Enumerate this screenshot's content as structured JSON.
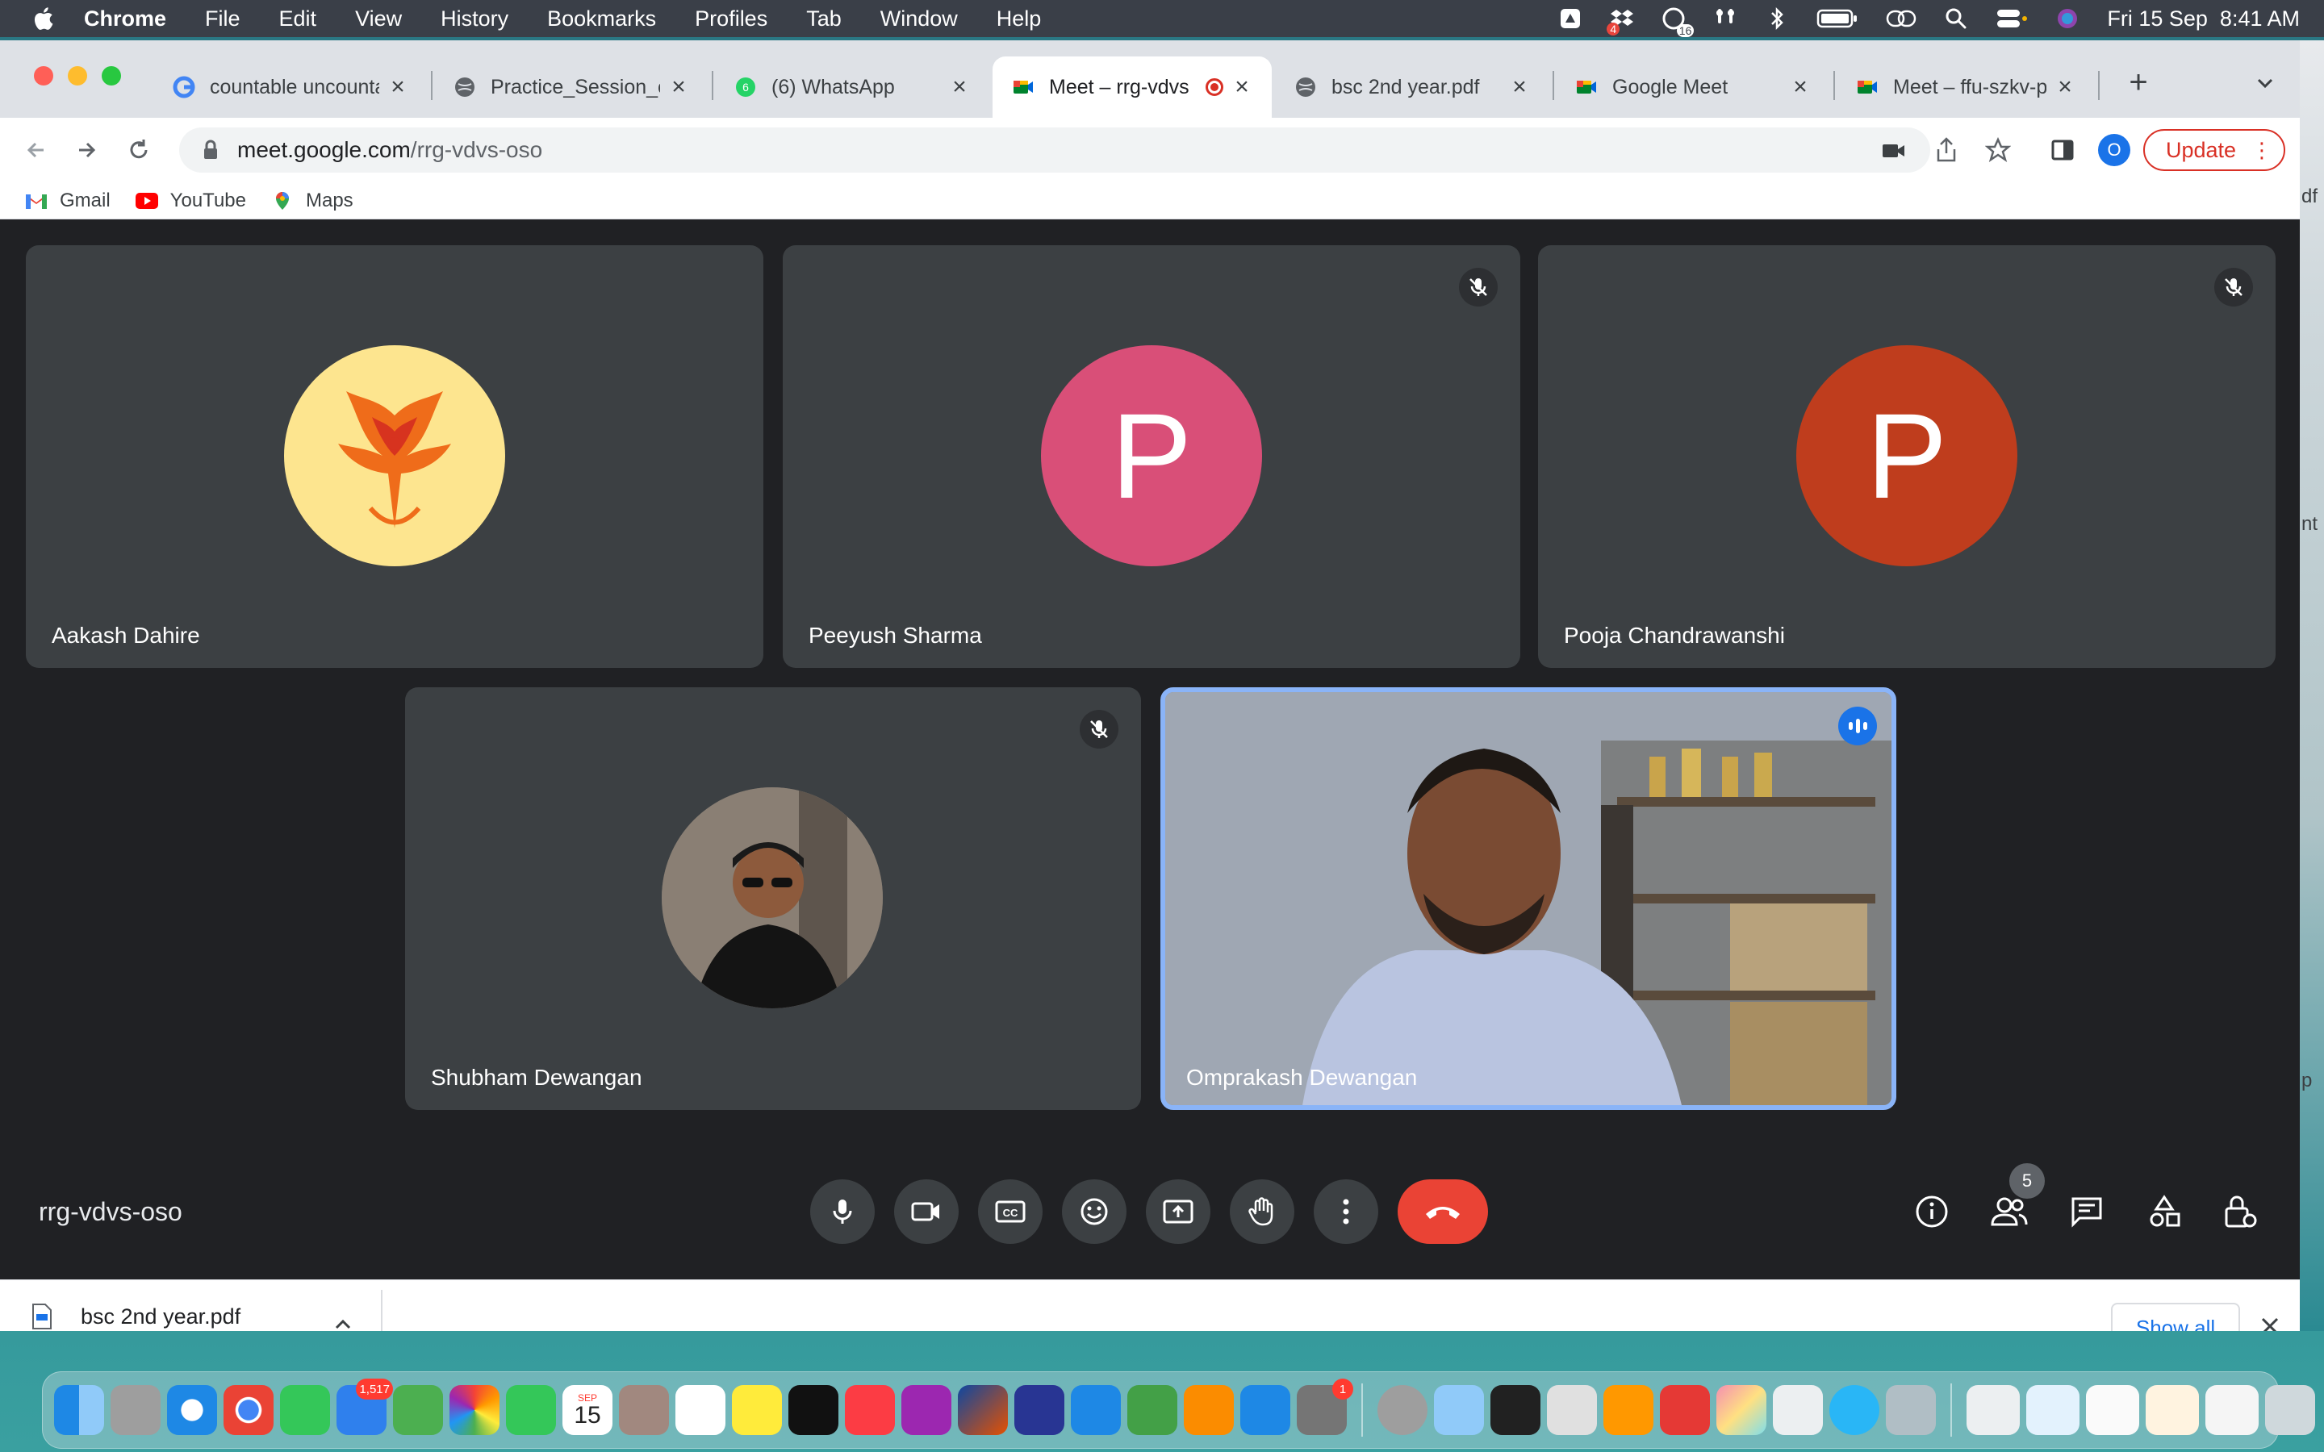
{
  "menubar": {
    "app": "Chrome",
    "items": [
      "File",
      "Edit",
      "View",
      "History",
      "Bookmarks",
      "Profiles",
      "Tab",
      "Window",
      "Help"
    ],
    "datetime": "Fri 15 Sep  8:41 AM",
    "notif_count_a": "4",
    "notif_count_b": "16"
  },
  "tabs": [
    {
      "label": "countable uncounta",
      "fav_color": "#4285f4"
    },
    {
      "label": "Practice_Session_c",
      "fav_color": "#5f6368"
    },
    {
      "label": "(6) WhatsApp",
      "fav_color": "#25d366",
      "badge": "6"
    },
    {
      "label": "Meet – rrg-vdvs",
      "fav_color": "#00832d",
      "active": true
    },
    {
      "label": "bsc 2nd year.pdf",
      "fav_color": "#5f6368"
    },
    {
      "label": "Google Meet",
      "fav_color": "#00832d"
    },
    {
      "label": "Meet – ffu-szkv-pe",
      "fav_color": "#00832d"
    }
  ],
  "toolbar": {
    "url_host": "meet.google.com",
    "url_path": "/rrg-vdvs-oso",
    "profile_initial": "O",
    "update_label": "Update"
  },
  "bookmarks": [
    {
      "label": "Gmail"
    },
    {
      "label": "YouTube"
    },
    {
      "label": "Maps"
    }
  ],
  "participants": [
    {
      "name": "Aakash Dahire",
      "avatar_type": "phoenix"
    },
    {
      "name": "Peeyush Sharma",
      "initial": "P",
      "color": "#d94f78",
      "muted": true
    },
    {
      "name": "Pooja Chandrawanshi",
      "initial": "P",
      "color": "#bf3d1d",
      "muted": true
    },
    {
      "name": "Shubham Dewangan",
      "avatar_type": "photo",
      "muted": true
    },
    {
      "name": "Omprakash Dewangan",
      "avatar_type": "video",
      "speaking": true
    }
  ],
  "meeting": {
    "code": "rrg-vdvs-oso",
    "participant_count": "5"
  },
  "download_shelf": {
    "file": "bsc 2nd year.pdf",
    "show_all": "Show all"
  },
  "dock_badges": {
    "mail": "1,517",
    "calendar_month": "SEP",
    "calendar_day": "15",
    "settings": "1"
  },
  "right_peek": [
    "df",
    "nt",
    "p"
  ],
  "colors": {
    "meet_bg": "#202124",
    "tile_bg": "#3c4043",
    "end_call": "#ea4335",
    "speaking_border": "#8ab4f8",
    "update_red": "#d93025",
    "link_blue": "#1a73e8"
  }
}
